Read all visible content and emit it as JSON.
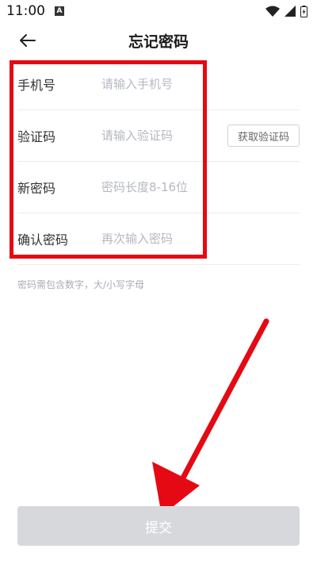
{
  "status_bar": {
    "time": "11:00",
    "app_badge": "A"
  },
  "header": {
    "title": "忘记密码"
  },
  "form": {
    "fields": [
      {
        "label": "手机号",
        "placeholder": "请输入手机号",
        "value": ""
      },
      {
        "label": "验证码",
        "placeholder": "请输入验证码",
        "value": ""
      },
      {
        "label": "新密码",
        "placeholder": "密码长度8-16位",
        "value": ""
      },
      {
        "label": "确认密码",
        "placeholder": "再次输入密码",
        "value": ""
      }
    ],
    "get_code_label": "获取验证码",
    "hint": "密码需包含数字，大/小写字母"
  },
  "submit": {
    "label": "提交"
  },
  "colors": {
    "annotation_red": "#e50914",
    "submit_disabled_bg": "#d6d8db",
    "placeholder_gray": "#b5b8c0"
  },
  "icons": [
    "back-arrow-icon",
    "wifi-icon",
    "signal-icon",
    "battery-icon"
  ]
}
